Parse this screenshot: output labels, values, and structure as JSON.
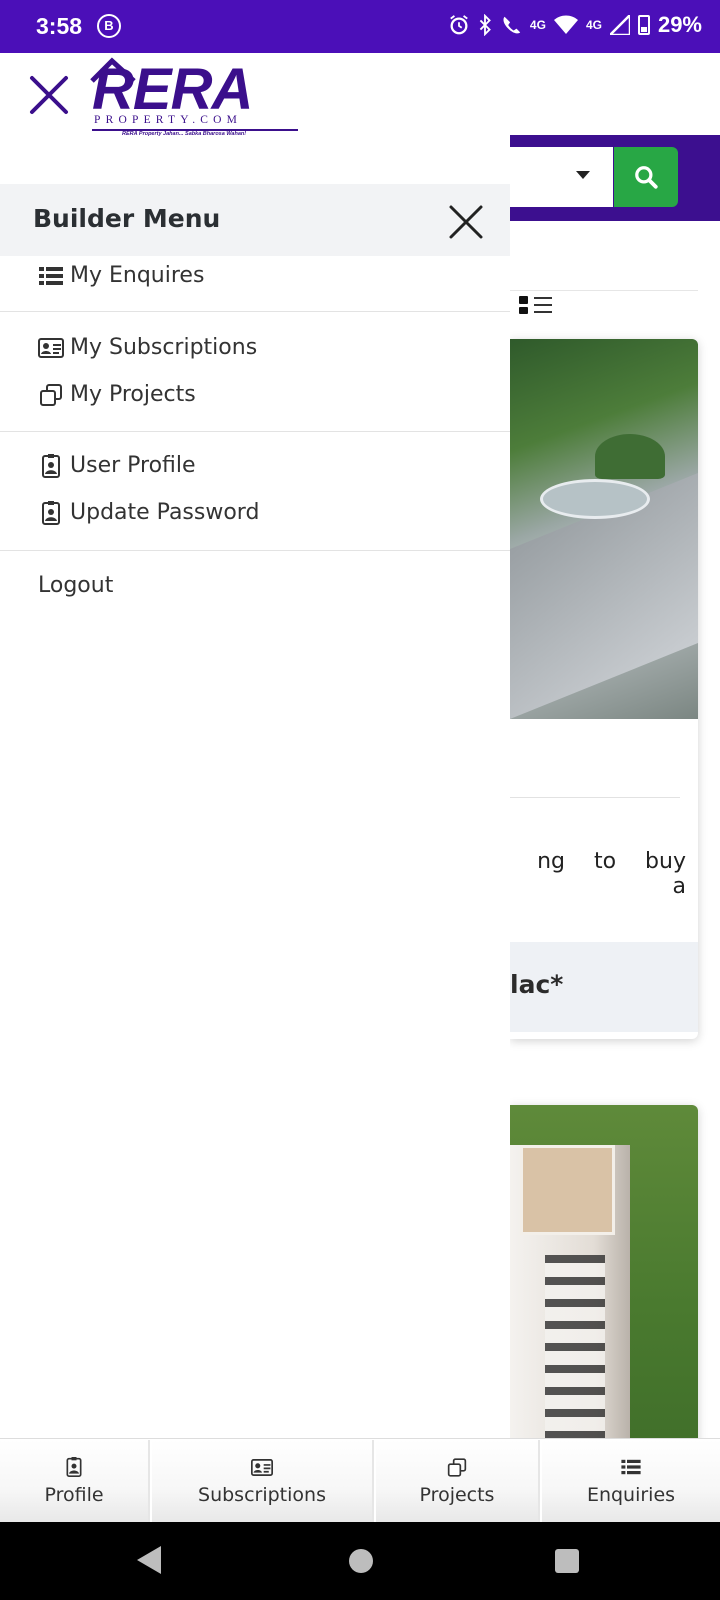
{
  "status_bar": {
    "time": "3:58",
    "b_badge": "B",
    "signal_4g_a": "4G",
    "signal_4g_b": "4G",
    "battery": "29%"
  },
  "background_page": {
    "card1_text": "ng to buy a",
    "card1_footer": "lac*"
  },
  "drawer": {
    "logo_text": "RERA",
    "logo_sub": "PROPERTY.COM",
    "logo_tagline": "RERA Property Jahan... Sabka Bharosa Wahan!",
    "menu_title": "Builder Menu",
    "items": {
      "enquires": "My Enquires",
      "subscriptions": "My Subscriptions",
      "projects": "My Projects",
      "user_profile": "User Profile",
      "update_password": "Update Password",
      "logout": "Logout"
    }
  },
  "bottom_nav": {
    "profile": "Profile",
    "subscriptions": "Subscriptions",
    "projects": "Projects",
    "enquiries": "Enquiries"
  },
  "colors": {
    "brand": "#3b0f8c",
    "status_bar": "#4b0fb8",
    "search_button": "#28a745"
  }
}
